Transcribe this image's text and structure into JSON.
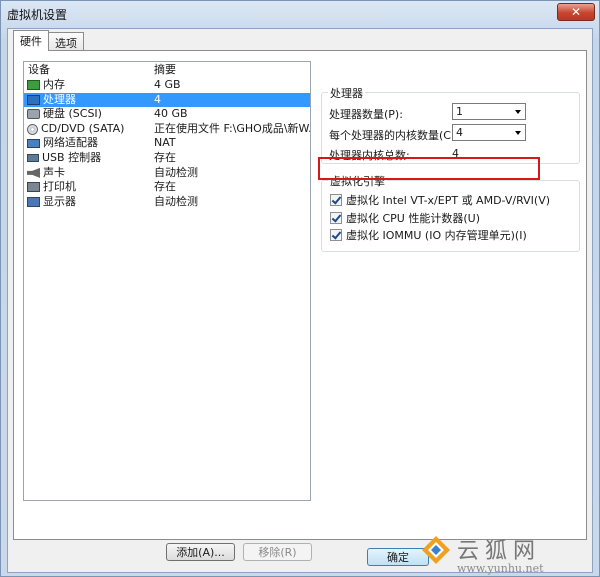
{
  "window": {
    "title": "虚拟机设置",
    "close_glyph": "✕"
  },
  "tabs": [
    {
      "label": "硬件",
      "active": true
    },
    {
      "label": "选项",
      "active": false
    }
  ],
  "device_list": {
    "columns": [
      "设备",
      "摘要"
    ],
    "rows": [
      {
        "name": "内存",
        "summary": "4 GB",
        "icon": "memory-icon",
        "selected": false
      },
      {
        "name": "处理器",
        "summary": "4",
        "icon": "processor-icon",
        "selected": true
      },
      {
        "name": "硬盘 (SCSI)",
        "summary": "40 GB",
        "icon": "hard-disk-icon",
        "selected": false
      },
      {
        "name": "CD/DVD (SATA)",
        "summary": "正在使用文件 F:\\GHO成品\\新W...",
        "icon": "cd-dvd-icon",
        "selected": false
      },
      {
        "name": "网络适配器",
        "summary": "NAT",
        "icon": "network-adapter-icon",
        "selected": false
      },
      {
        "name": "USB 控制器",
        "summary": "存在",
        "icon": "usb-controller-icon",
        "selected": false
      },
      {
        "name": "声卡",
        "summary": "自动检测",
        "icon": "sound-card-icon",
        "selected": false
      },
      {
        "name": "打印机",
        "summary": "存在",
        "icon": "printer-icon",
        "selected": false
      },
      {
        "name": "显示器",
        "summary": "自动检测",
        "icon": "display-icon",
        "selected": false
      }
    ]
  },
  "buttons": {
    "add": "添加(A)...",
    "remove": "移除(R)",
    "ok": "确定"
  },
  "processor_group": {
    "title": "处理器",
    "count_label": "处理器数量(P):",
    "count_value": "1",
    "cores_label": "每个处理器的内核数量(C):",
    "cores_value": "4",
    "total_label": "处理器内核总数:",
    "total_value": "4"
  },
  "virtualization_group": {
    "title": "虚拟化引擎",
    "options": [
      {
        "label": "虚拟化 Intel VT-x/EPT 或 AMD-V/RVI(V)",
        "checked": true
      },
      {
        "label": "虚拟化 CPU 性能计数器(U)",
        "checked": true
      },
      {
        "label": "虚拟化 IOMMU (IO 内存管理单元)(I)",
        "checked": true
      }
    ]
  },
  "watermark": {
    "title": "云狐网",
    "url": "www.yunhu.net"
  },
  "colors": {
    "selection": "#3399ff",
    "highlight": "#d81818"
  }
}
